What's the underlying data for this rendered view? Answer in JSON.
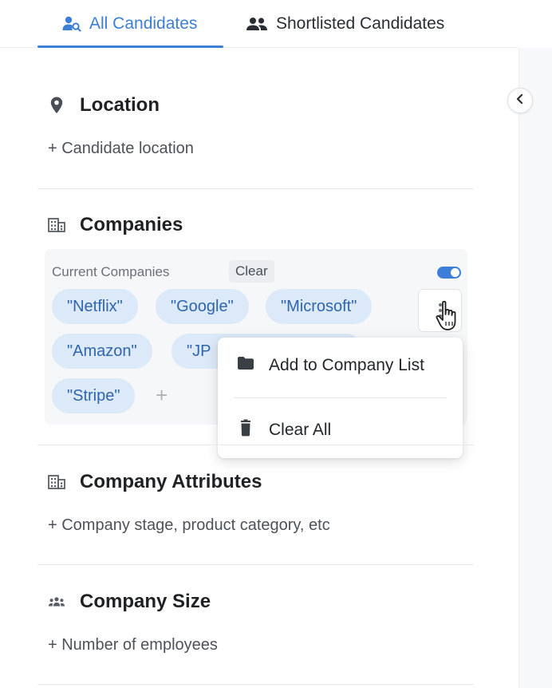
{
  "tabs": {
    "all_candidates": "All Candidates",
    "shortlisted_candidates": "Shortlisted Candidates"
  },
  "location": {
    "title": "Location",
    "add": "+ Candidate location"
  },
  "companies": {
    "title": "Companies",
    "current_label": "Current Companies",
    "clear_label": "Clear",
    "toggle_on": true,
    "chips": [
      "\"Netflix\"",
      "\"Google\"",
      "\"Microsoft\"",
      "\"Amazon\"",
      "\"JP",
      "\"Stripe\""
    ],
    "add_chip": "+"
  },
  "context_menu": {
    "add_to_list": "Add to Company List",
    "clear_all": "Clear All"
  },
  "company_attributes": {
    "title": "Company Attributes",
    "add": "+ Company stage, product category, etc"
  },
  "company_size": {
    "title": "Company Size",
    "add": "+ Number of employees"
  },
  "colors": {
    "accent": "#3d7fd6",
    "chip_bg": "#dce9f8",
    "chip_text": "#2f65ad"
  },
  "icons": {
    "all_candidates": "person-search-icon",
    "shortlisted": "people-icon",
    "location": "location-pin-icon",
    "companies": "building-icon",
    "company_attributes": "building-icon",
    "company_size": "people-group-icon",
    "more": "more-vertical-icon",
    "collapse": "chevron-left-icon",
    "folder": "folder-icon",
    "trash": "trash-icon"
  }
}
